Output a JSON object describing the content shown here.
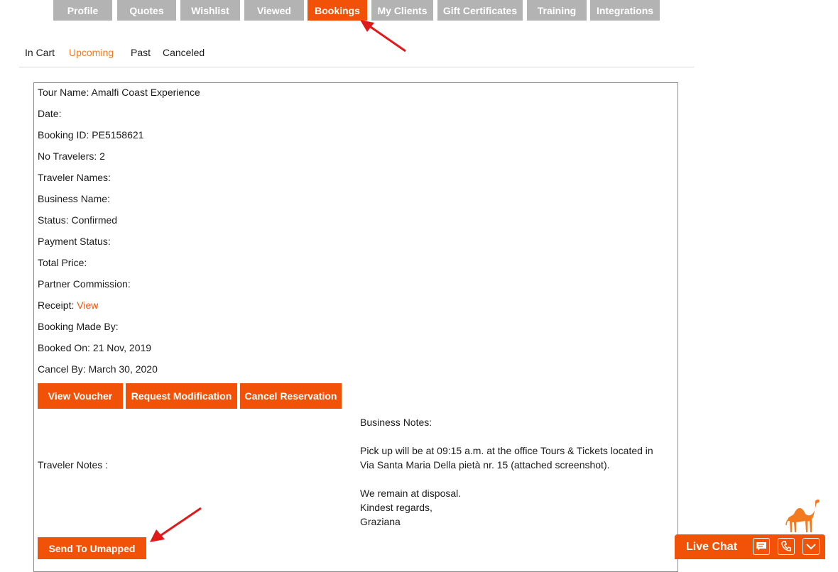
{
  "tabs": [
    {
      "label": "Profile"
    },
    {
      "label": "Quotes"
    },
    {
      "label": "Wishlist"
    },
    {
      "label": "Viewed"
    },
    {
      "label": "Bookings",
      "active": true
    },
    {
      "label": "My Clients"
    },
    {
      "label": "Gift Certificates"
    },
    {
      "label": "Training"
    },
    {
      "label": "Integrations"
    }
  ],
  "subtabs": [
    {
      "label": "In Cart"
    },
    {
      "label": "Upcoming",
      "active": true
    },
    {
      "label": "Past"
    },
    {
      "label": "Canceled"
    }
  ],
  "booking": {
    "tour_name": "Tour Name: Amalfi Coast Experience",
    "date": "Date:",
    "booking_id": "Booking ID: PE5158621",
    "no_travelers": "No Travelers: 2",
    "traveler_names": "Traveler Names:",
    "business_name": "Business Name:",
    "status": "Status: Confirmed",
    "payment_status": "Payment Status:",
    "total_price": "Total Price:",
    "partner_commission": "Partner Commission:",
    "receipt_label": "Receipt:",
    "receipt_link": "View",
    "booking_made_by": "Booking Made By:",
    "booked_on": "Booked On: 21 Nov, 2019",
    "cancel_by": "Cancel By: March 30, 2020"
  },
  "actions": {
    "view_voucher": "View Voucher",
    "request_modification": "Request Modification",
    "cancel_reservation": "Cancel Reservation",
    "send_to_umapped": "Send To Umapped"
  },
  "notes": {
    "traveler_label": "Traveler Notes :",
    "business_label": "Business Notes:",
    "business_line1": "Pick up will be at 09:15 a.m. at the office Tours & Tickets located in",
    "business_line2": "Via Santa Maria Della pietà nr. 15 (attached screenshot).",
    "business_line3": "We remain at disposal.",
    "business_line4": "Kindest regards,",
    "business_line5": "Graziana"
  },
  "chat": {
    "label": "Live Chat",
    "icons": [
      "chat-icon",
      "phone-icon",
      "chevron-down-icon"
    ]
  },
  "colors": {
    "accent": "#f25208",
    "tab_inactive": "#b3b3b3",
    "subtab_active": "#f47a1f",
    "annotation_arrow": "#e0191b"
  }
}
